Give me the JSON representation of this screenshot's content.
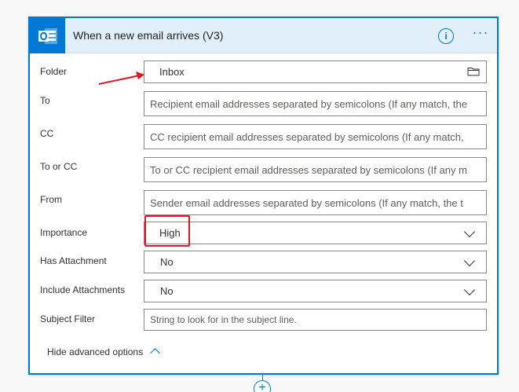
{
  "trigger": {
    "title": "When a new email arrives (V3)",
    "info_glyph": "i",
    "more_glyph": "···",
    "icon": "outlook-icon"
  },
  "fields": {
    "folder": {
      "label": "Folder",
      "value": "Inbox",
      "icon": "folder-icon"
    },
    "to": {
      "label": "To",
      "placeholder": "Recipient email addresses separated by semicolons (If any match, the"
    },
    "cc": {
      "label": "CC",
      "placeholder": "CC recipient email addresses separated by semicolons (If any match,"
    },
    "to_or_cc": {
      "label": "To or CC",
      "placeholder": "To or CC recipient email addresses separated by semicolons (If any m"
    },
    "from": {
      "label": "From",
      "placeholder": "Sender email addresses separated by semicolons (If any match, the t"
    },
    "importance": {
      "label": "Importance",
      "value": "High"
    },
    "has_attachment": {
      "label": "Has Attachment",
      "value": "No"
    },
    "include_attachments": {
      "label": "Include Attachments",
      "value": "No"
    },
    "subject_filter": {
      "label": "Subject Filter",
      "placeholder": "String to look for in the subject line."
    }
  },
  "advanced": {
    "label": "Hide advanced options"
  },
  "add_step_glyph": "+",
  "colors": {
    "accent": "#0078d4",
    "annotation": "#e81123",
    "header_bg": "#e1effa"
  }
}
